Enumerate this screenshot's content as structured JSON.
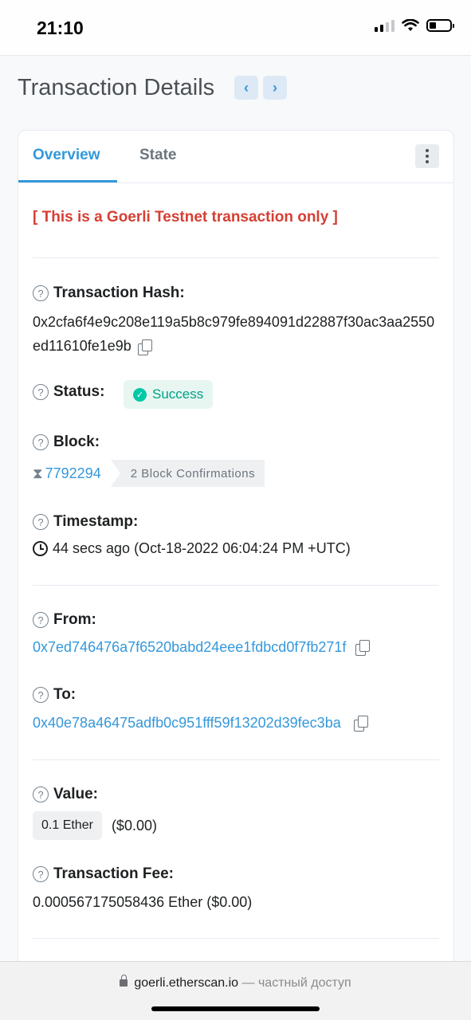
{
  "status_bar": {
    "time": "21:10"
  },
  "header": {
    "title": "Transaction Details",
    "prev_label": "‹",
    "next_label": "›"
  },
  "tabs": [
    {
      "label": "Overview",
      "active": true
    },
    {
      "label": "State",
      "active": false
    }
  ],
  "testnet_notice": "[ This is a Goerli Testnet transaction only ]",
  "fields": {
    "tx_hash": {
      "label": "Transaction Hash:",
      "value": "0x2cfa6f4e9c208e119a5b8c979fe894091d22887f30ac3aa2550ed11610fe1e9b"
    },
    "status": {
      "label": "Status:",
      "value": "Success"
    },
    "block": {
      "label": "Block:",
      "number": "7792294",
      "confirmations": "2 Block Confirmations"
    },
    "timestamp": {
      "label": "Timestamp:",
      "value": "44 secs ago (Oct-18-2022 06:04:24 PM +UTC)"
    },
    "from": {
      "label": "From:",
      "value": "0x7ed746476a7f6520babd24eee1fdbcd0f7fb271f"
    },
    "to": {
      "label": "To:",
      "value": "0x40e78a46475adfb0c951fff59f13202d39fec3ba"
    },
    "value": {
      "label": "Value:",
      "amount": "0.1 Ether",
      "usd": "($0.00)"
    },
    "fee": {
      "label": "Transaction Fee:",
      "value": "0.000567175058436 Ether ($0.00)"
    }
  },
  "browser": {
    "domain": "goerli.etherscan.io",
    "suffix": " — частный доступ"
  },
  "colors": {
    "link": "#3498db",
    "danger": "#d63f33",
    "success": "#00a186"
  }
}
